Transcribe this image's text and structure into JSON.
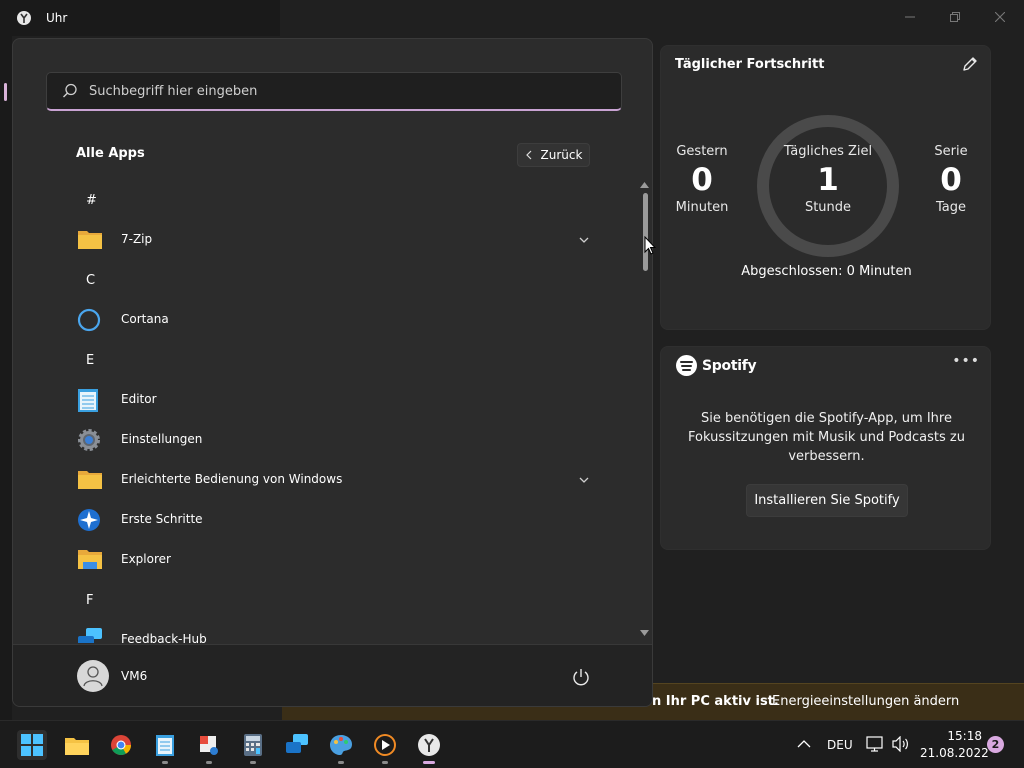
{
  "window": {
    "title": "Uhr",
    "controls": [
      "minimize",
      "maximize",
      "close"
    ]
  },
  "progress_card": {
    "title": "Täglicher Fortschritt",
    "yesterday": {
      "label": "Gestern",
      "value": "0",
      "unit": "Minuten"
    },
    "goal": {
      "label": "Tägliches Ziel",
      "value": "1",
      "unit": "Stunde"
    },
    "streak": {
      "label": "Serie",
      "value": "0",
      "unit": "Tage"
    },
    "completed": "Abgeschlossen: 0 Minuten"
  },
  "spotify_card": {
    "brand": "Spotify",
    "message": "Sie benötigen die Spotify-App, um Ihre Fokussitzungen mit Musik und Podcasts zu verbessern.",
    "install_label": "Installieren Sie Spotify"
  },
  "notification": {
    "text": "n Ihr PC aktiv ist.",
    "link": "Energieeinstellungen ändern"
  },
  "start_menu": {
    "search_placeholder": "Suchbegriff hier eingeben",
    "heading": "Alle Apps",
    "back_label": "Zurück",
    "rows": [
      {
        "type": "letter",
        "text": "#"
      },
      {
        "type": "app",
        "name": "7-Zip",
        "icon": "folder-icon",
        "expandable": true
      },
      {
        "type": "letter",
        "text": "C"
      },
      {
        "type": "app",
        "name": "Cortana",
        "icon": "cortana-icon",
        "expandable": false
      },
      {
        "type": "letter",
        "text": "E"
      },
      {
        "type": "app",
        "name": "Editor",
        "icon": "notepad-icon",
        "expandable": false
      },
      {
        "type": "app",
        "name": "Einstellungen",
        "icon": "settings-gear-icon",
        "expandable": false
      },
      {
        "type": "app",
        "name": "Erleichterte Bedienung von Windows",
        "icon": "folder-icon",
        "expandable": true
      },
      {
        "type": "app",
        "name": "Erste Schritte",
        "icon": "get-started-icon",
        "expandable": false
      },
      {
        "type": "app",
        "name": "Explorer",
        "icon": "file-explorer-icon",
        "expandable": false
      },
      {
        "type": "letter",
        "text": "F"
      },
      {
        "type": "app",
        "name": "Feedback-Hub",
        "icon": "feedback-hub-icon",
        "expandable": false
      }
    ],
    "user_name": "VM6"
  },
  "taskbar": {
    "apps": [
      "start-icon",
      "file-explorer-icon",
      "chrome-icon",
      "notepad-icon",
      "snipping-tool-icon",
      "calculator-icon",
      "feedback-hub-icon",
      "paint-icon",
      "media-player-icon",
      "clock-icon"
    ],
    "language": "DEU",
    "time": "15:18",
    "date": "21.08.2022",
    "notification_count": "2"
  },
  "colors": {
    "accent": "#d9a9e0",
    "card": "#2b2b2b",
    "background": "#202020",
    "notification": "#3a2e17"
  }
}
